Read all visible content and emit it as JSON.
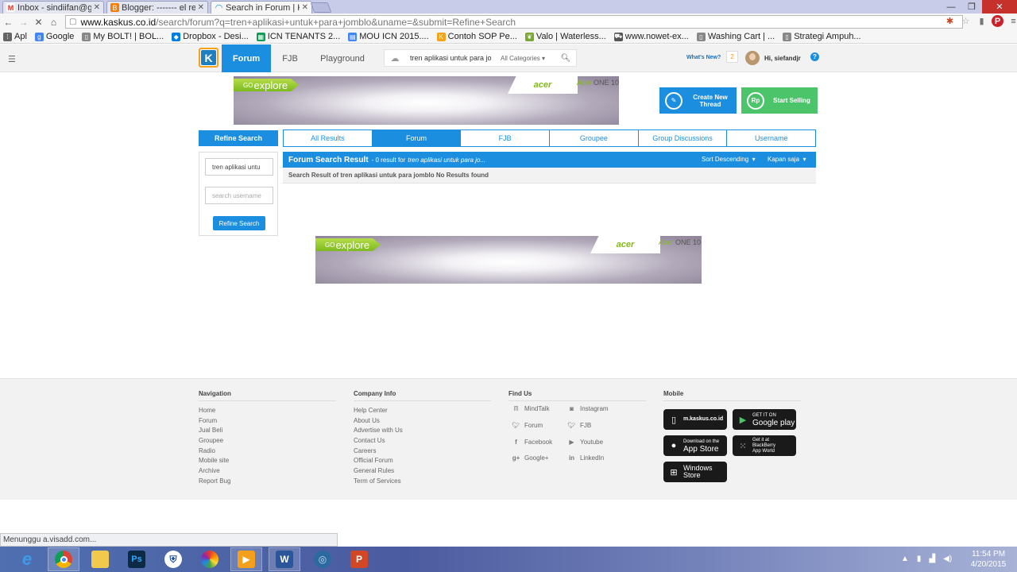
{
  "browser": {
    "tabs": [
      {
        "title": "Inbox - sindiifan@gm",
        "icon": "gmail-icon",
        "color": "#d93025",
        "glyph": "M"
      },
      {
        "title": "Blogger: ------- el re",
        "icon": "blogger-icon",
        "color": "#f57d00",
        "glyph": "B"
      },
      {
        "title": "Search in Forum | Ka",
        "icon": "loading-icon",
        "color": "#1b8ee0",
        "glyph": "◠"
      }
    ],
    "url_domain": "www.kaskus.co.id",
    "url_path": "/search/forum?q=tren+aplikasi+untuk+para+jomblo&uname=&submit=Refine+Search",
    "bookmarks": [
      {
        "label": "Apl",
        "icon": "apps-grid-icon",
        "color": "#666"
      },
      {
        "label": "Google",
        "icon": "google-icon",
        "color": "#4285f4"
      },
      {
        "label": "My BOLT! | BOL...",
        "icon": "bookmark-page-icon",
        "color": "#888"
      },
      {
        "label": "Dropbox - Desi...",
        "icon": "dropbox-icon",
        "color": "#007ee5"
      },
      {
        "label": "ICN TENANTS 2...",
        "icon": "sheets-icon",
        "color": "#0f9d58"
      },
      {
        "label": "MOU ICN 2015....",
        "icon": "docs-icon",
        "color": "#4285f4"
      },
      {
        "label": "Contoh SOP Pe...",
        "icon": "kaskus-bookmark-icon",
        "color": "#f6a21a"
      },
      {
        "label": "Valo | Waterless...",
        "icon": "leaf-icon",
        "color": "#7aa833"
      },
      {
        "label": "www.nowet-ex...",
        "icon": "cart-icon",
        "color": "#555"
      },
      {
        "label": "Washing Cart | ...",
        "icon": "bookmark-page-icon",
        "color": "#888"
      },
      {
        "label": "Strategi Ampuh...",
        "icon": "bookmark-page-icon",
        "color": "#888"
      }
    ]
  },
  "header": {
    "nav": [
      "Forum",
      "FJB",
      "Playground"
    ],
    "search_query": "tren aplikasi untuk para jo",
    "category": "All Categories",
    "whats_new": "What's New?",
    "notif_count": "2",
    "greeting": "Hi, siefandjr"
  },
  "ads": {
    "tag_small": "GO",
    "tag": "explore",
    "brand": "acer",
    "product_brand": "Acer",
    "product_model": "ONE 10"
  },
  "actions": {
    "create_thread": "Create New Thread",
    "start_selling": "Start Selling",
    "create_color": "#1b8ee0",
    "selling_color": "#4cc56a"
  },
  "refine": {
    "title": "Refine Search",
    "query_value": "tren aplikasi untu",
    "username_placeholder": "search username",
    "button": "Refine Search"
  },
  "filters": [
    "All Results",
    "Forum",
    "FJB",
    "Groupee",
    "Group Discussions",
    "Username"
  ],
  "results": {
    "title": "Forum Search Result",
    "count_text": "- 0 result for",
    "query": "tren aplikasi untuk para jo...",
    "sort": "Sort Descending",
    "time": "Kapan saja",
    "empty_message": "Search Result of tren aplikasi untuk para jomblo No Results found"
  },
  "footer": {
    "navigation": {
      "title": "Navigation",
      "links": [
        "Home",
        "Forum",
        "Jual Beli",
        "Groupee",
        "Radio",
        "Mobile site",
        "Archive",
        "Report Bug"
      ]
    },
    "company": {
      "title": "Company Info",
      "links": [
        "Help Center",
        "About Us",
        "Advertise with Us",
        "Contact Us",
        "Careers",
        "Official Forum",
        "General Rules",
        "Term of Services"
      ]
    },
    "findus": {
      "title": "Find Us",
      "left": [
        "MindTalk",
        "Forum",
        "Facebook",
        "Google+"
      ],
      "right": [
        "Instagram",
        "FJB",
        "Youtube",
        "LinkedIn"
      ]
    },
    "mobile": {
      "title": "Mobile",
      "mkaskus": "m.kaskus.co.id",
      "gplay_small": "GET IT ON",
      "gplay": "Google play",
      "appstore_small": "Download on the",
      "appstore": "App Store",
      "bb_small": "Get it at",
      "bb": "BlackBerry App World",
      "windows_1": "Windows",
      "windows_2": "Store"
    }
  },
  "status": "Menunggu a.visadd.com...",
  "taskbar": {
    "time": "11:54 PM",
    "date": "4/20/2015"
  }
}
